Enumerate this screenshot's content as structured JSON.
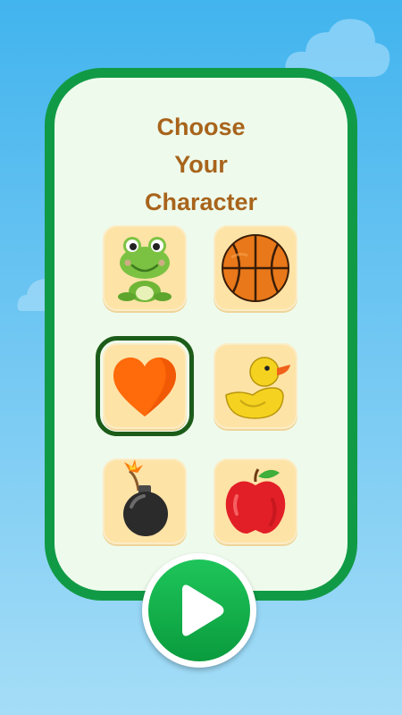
{
  "title": {
    "line1": "Choose",
    "line2": "Your",
    "line3": "Character"
  },
  "characters": [
    {
      "name": "frog",
      "selected": false
    },
    {
      "name": "basketball",
      "selected": false
    },
    {
      "name": "heart",
      "selected": true
    },
    {
      "name": "rubber-duck",
      "selected": false
    },
    {
      "name": "bomb",
      "selected": false
    },
    {
      "name": "apple",
      "selected": false
    }
  ],
  "play_button": {
    "icon": "play-icon"
  },
  "colors": {
    "panel_border": "#119a46",
    "panel_background": "#eefbec",
    "title": "#a8641c",
    "tile": "#fee3a7",
    "selected_outline": "#1c5c19",
    "play": "#14b24c"
  }
}
